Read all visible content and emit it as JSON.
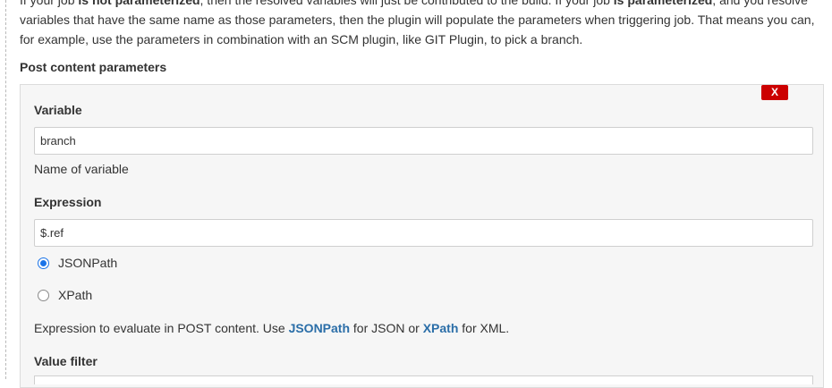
{
  "intro": {
    "line1_pre": "If your job ",
    "line1_bold1": "is not parameterized",
    "line1_mid": ", then the resolved variables will just be contributed to the build. If your job ",
    "line1_bold2": "is parameterized",
    "line1_post": ", and you resolve",
    "line2": "variables that have the same name as those parameters, then the plugin will populate the parameters when triggering job. That means you can,",
    "line3": "for example, use the parameters in combination with an SCM plugin, like GIT Plugin, to pick a branch."
  },
  "section": {
    "title": "Post content parameters"
  },
  "parameter": {
    "delete_label": "X",
    "variable_label": "Variable",
    "variable_value": "branch",
    "variable_help": "Name of variable",
    "expression_label": "Expression",
    "expression_value": "$.ref",
    "radio_jsonpath": "JSONPath",
    "radio_xpath": "XPath",
    "selected_type": "JSONPath",
    "expression_help_pre": "Expression to evaluate in POST content. Use ",
    "expression_help_link1": "JSONPath",
    "expression_help_mid": " for JSON or ",
    "expression_help_link2": "XPath",
    "expression_help_post": " for XML.",
    "value_filter_label": "Value filter"
  },
  "colors": {
    "delete_button": "#cc0000",
    "link": "#2b6ea8",
    "radio_selected": "#1a73e8"
  }
}
